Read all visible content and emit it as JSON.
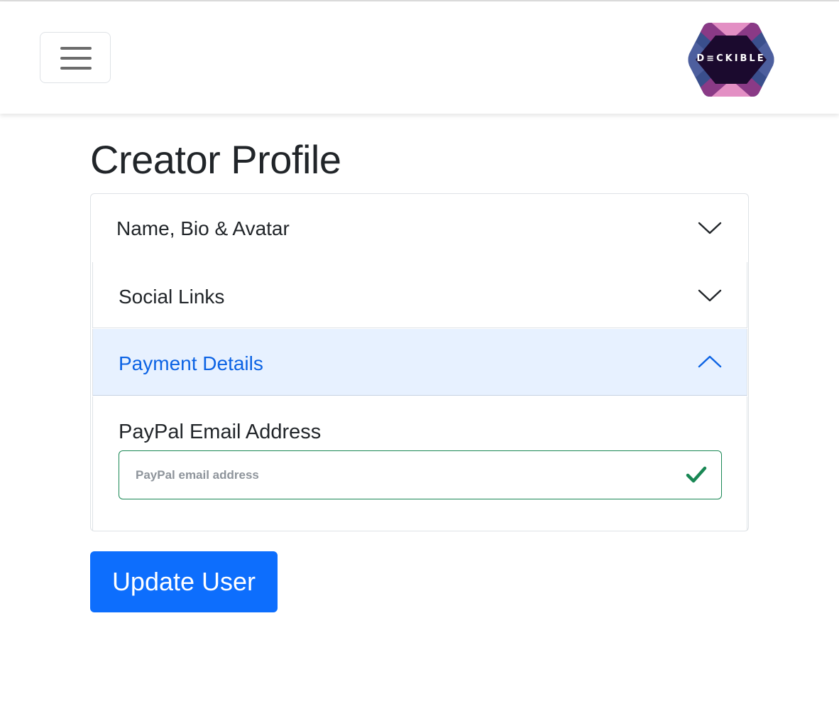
{
  "header": {
    "menu_icon": "hamburger-icon",
    "logo_text": "D≡CKIBLE"
  },
  "page": {
    "title": "Creator Profile"
  },
  "accordion": {
    "items": [
      {
        "label": "Name, Bio & Avatar",
        "state": "collapsed",
        "icon": "chevron-down-icon"
      },
      {
        "label": "Social Links",
        "state": "collapsed",
        "icon": "chevron-down-icon"
      },
      {
        "label": "Payment Details",
        "state": "expanded",
        "icon": "chevron-up-icon"
      }
    ],
    "payment": {
      "field_label": "PayPal Email Address",
      "email_value": "",
      "email_placeholder": "PayPal email address",
      "valid_icon": "checkmark-icon"
    }
  },
  "actions": {
    "submit_label": "Update User"
  },
  "colors": {
    "primary": "#0d6efd",
    "active_header_bg": "#e7f1ff",
    "active_header_text": "#0c63e4",
    "valid": "#198754"
  }
}
